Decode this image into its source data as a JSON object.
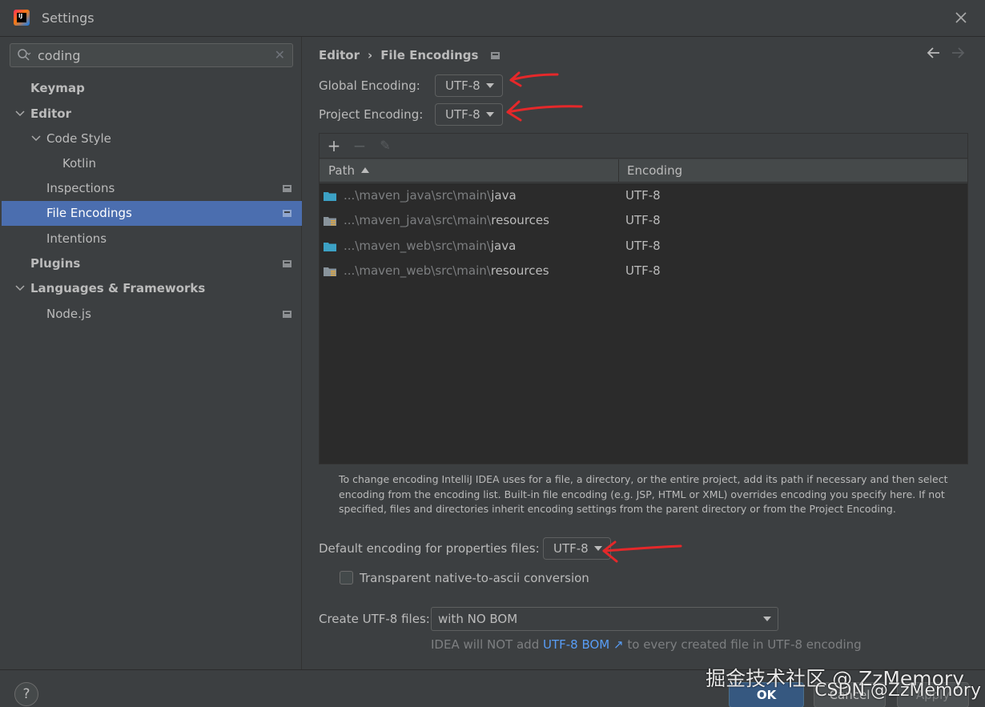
{
  "window": {
    "title": "Settings",
    "close_icon": "close-icon"
  },
  "search": {
    "value": "coding",
    "icon": "search-icon",
    "clear_icon": "clear-icon"
  },
  "sidebar": {
    "items": [
      {
        "label": "Keymap"
      },
      {
        "label": "Editor"
      },
      {
        "label": "Code Style"
      },
      {
        "label": "Kotlin"
      },
      {
        "label": "Inspections"
      },
      {
        "label": "File Encodings"
      },
      {
        "label": "Intentions"
      },
      {
        "label": "Plugins"
      },
      {
        "label": "Languages & Frameworks"
      },
      {
        "label": "Node.js"
      }
    ]
  },
  "breadcrumb": {
    "parent": "Editor",
    "current": "File Encodings"
  },
  "encodings": {
    "global_label": "Global Encoding:",
    "global_value": "UTF-8",
    "project_label": "Project Encoding:",
    "project_value": "UTF-8"
  },
  "table": {
    "toolbar": {
      "add": "+",
      "remove": "−",
      "edit": "✎"
    },
    "columns": {
      "path": "Path",
      "encoding": "Encoding"
    },
    "rows": [
      {
        "path_dim": "...\\maven_java\\src\\main\\",
        "path_strong": "java",
        "encoding": "UTF-8",
        "icon": "source-folder-icon"
      },
      {
        "path_dim": "...\\maven_java\\src\\main\\",
        "path_strong": "resources",
        "encoding": "UTF-8",
        "icon": "resources-folder-icon"
      },
      {
        "path_dim": "...\\maven_web\\src\\main\\",
        "path_strong": "java",
        "encoding": "UTF-8",
        "icon": "source-folder-icon"
      },
      {
        "path_dim": "...\\maven_web\\src\\main\\",
        "path_strong": "resources",
        "encoding": "UTF-8",
        "icon": "resources-folder-icon"
      }
    ]
  },
  "help_text": "To change encoding IntelliJ IDEA uses for a file, a directory, or the entire project, add its path if necessary and then select encoding from the encoding list. Built-in file encoding (e.g. JSP, HTML or XML) overrides encoding you specify here. If not specified, files and directories inherit encoding settings from the parent directory or from the Project Encoding.",
  "properties": {
    "label": "Default encoding for properties files:",
    "value": "UTF-8"
  },
  "transparent": {
    "label": "Transparent native-to-ascii conversion",
    "checked": false
  },
  "bom": {
    "label": "Create UTF-8 files:",
    "value": "with NO BOM",
    "note_before": "IDEA will NOT add ",
    "note_link": "UTF-8 BOM ↗",
    "note_after": " to every created file in UTF-8 encoding"
  },
  "footer": {
    "help": "?",
    "ok": "OK",
    "cancel": "Cancel",
    "apply": "Apply"
  },
  "watermark": {
    "line1": "掘金技术社区 @ ZzMemory",
    "line2": "CSDN @ZzMemory"
  },
  "colors": {
    "background": "#3c3f41",
    "selection": "#4b6eaf",
    "link": "#589df6",
    "ok_button": "#365880",
    "annotation": "#e5282a"
  }
}
